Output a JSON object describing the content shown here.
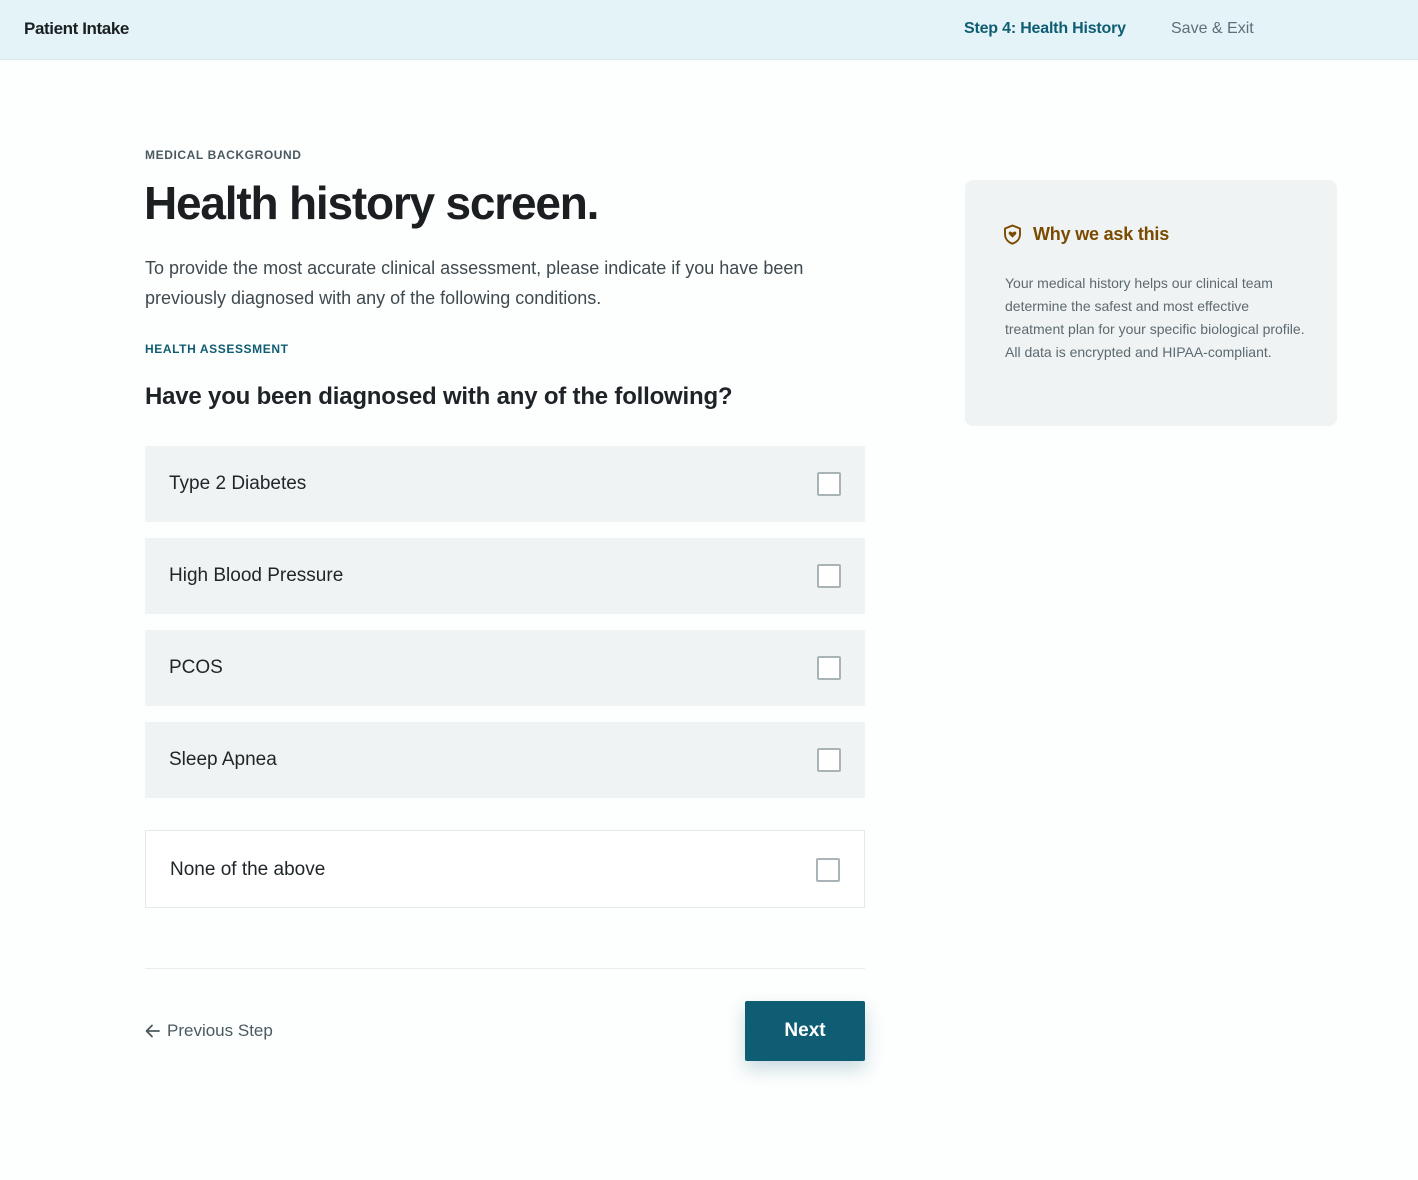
{
  "header": {
    "brand": "Patient Intake",
    "step": "Step 4: Health History",
    "save_exit": "Save & Exit"
  },
  "main": {
    "eyebrow": "MEDICAL BACKGROUND",
    "title": "Health history screen.",
    "intro": "To provide the most accurate clinical assessment, please indicate if you have been previously diagnosed with any of the following conditions.",
    "section_label": "HEALTH ASSESSMENT",
    "question": "Have you been diagnosed with any of the following?",
    "options": [
      {
        "label": "Type 2 Diabetes",
        "checked": false
      },
      {
        "label": "High Blood Pressure",
        "checked": false
      },
      {
        "label": "PCOS",
        "checked": false
      },
      {
        "label": "Sleep Apnea",
        "checked": false
      }
    ],
    "none_option": {
      "label": "None of the above",
      "checked": false
    }
  },
  "footer": {
    "prev_label": "Previous Step",
    "next_label": "Next"
  },
  "aside": {
    "icon": "shield-heart-icon",
    "title": "Why we ask this",
    "body": "Your medical history helps our clinical team determine the safest and most effective treatment plan for your specific biological profile. All data is encrypted and HIPAA-compliant."
  },
  "colors": {
    "primary": "#0f5d73",
    "header_bg": "#e4f3f8",
    "option_bg": "#f0f3f4",
    "aside_accent": "#7a4a00"
  }
}
